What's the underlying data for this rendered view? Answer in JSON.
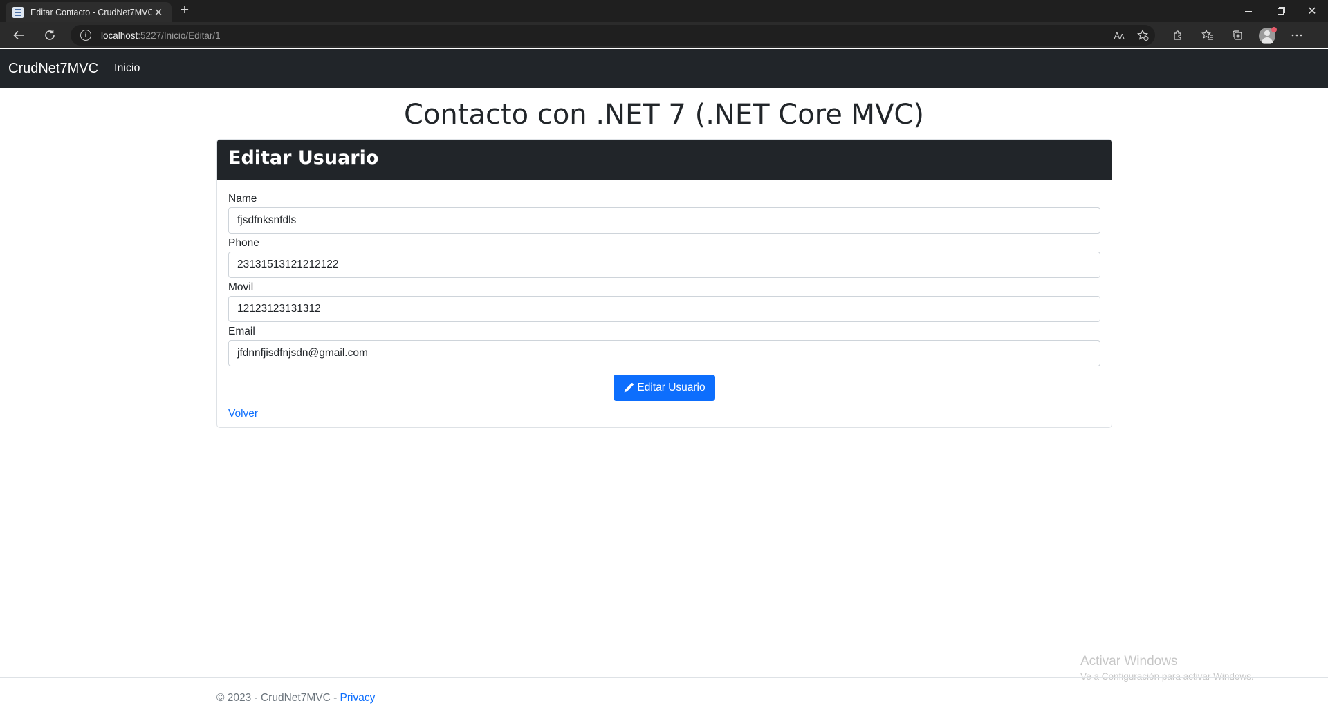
{
  "browser": {
    "tab_title": "Editar Contacto - CrudNet7MVC",
    "tab_close": "✕",
    "new_tab": "+",
    "url_host": "localhost",
    "url_rest": ":5227/Inicio/Editar/1",
    "read_aloud": "Aᴀ",
    "window": {
      "minimize": "",
      "restore": "",
      "close": "✕"
    }
  },
  "navbar": {
    "brand": "CrudNet7MVC",
    "links": [
      {
        "label": "Inicio"
      }
    ]
  },
  "page": {
    "title": "Contacto con .NET 7 (.NET Core MVC)"
  },
  "card": {
    "header": "Editar Usuario",
    "fields": [
      {
        "label": "Name",
        "value": "fjsdfnksnfdls"
      },
      {
        "label": "Phone",
        "value": "23131513121212122"
      },
      {
        "label": "Movil",
        "value": "12123123131312"
      },
      {
        "label": "Email",
        "value": "jfdnnfjisdfnjsdn@gmail.com"
      }
    ],
    "submit_label": "Editar Usuario",
    "back_label": "Volver"
  },
  "footer": {
    "text": "© 2023 - CrudNet7MVC - ",
    "privacy_label": "Privacy"
  },
  "watermark": {
    "title": "Activar Windows",
    "subtitle": "Ve a Configuración para activar Windows."
  },
  "colors": {
    "navbar": "#212529",
    "primary": "#0d6efd",
    "chrome": "#1f1f1f"
  }
}
